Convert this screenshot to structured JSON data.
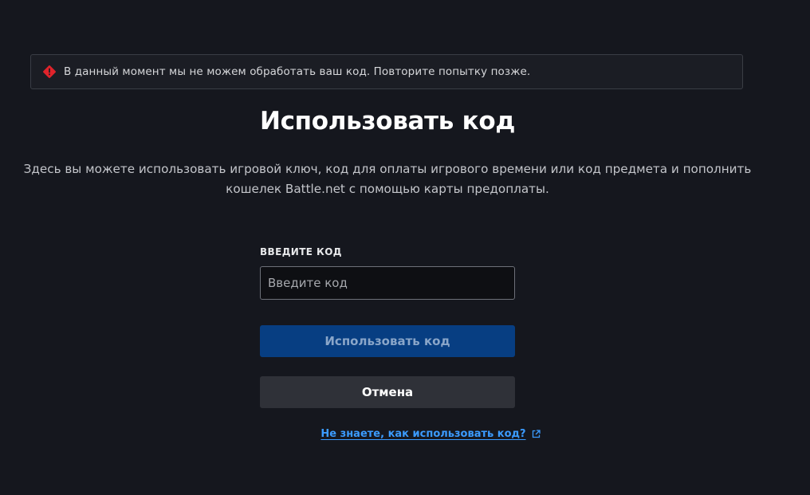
{
  "alert": {
    "icon": "error-diamond-icon",
    "color": "#e0232b",
    "message": "В данный момент мы не можем обработать ваш код. Повторите попытку позже."
  },
  "page": {
    "title": "Использовать код",
    "description": "Здесь вы можете использовать игровой ключ, код для оплаты игрового времени или код предмета и пополнить кошелек Battle.net с помощью карты предоплаты."
  },
  "form": {
    "label": "ВВЕДИТЕ КОД",
    "placeholder": "Введите код",
    "value": "",
    "submit_label": "Использовать код",
    "cancel_label": "Отмена",
    "help_link_label": "Не знаете, как использовать код?",
    "help_link_icon": "external-link-icon"
  },
  "colors": {
    "background": "#15171e",
    "primary_button": "#073e82",
    "secondary_button": "#2f3138",
    "link": "#3b9bff",
    "error": "#e0232b"
  }
}
